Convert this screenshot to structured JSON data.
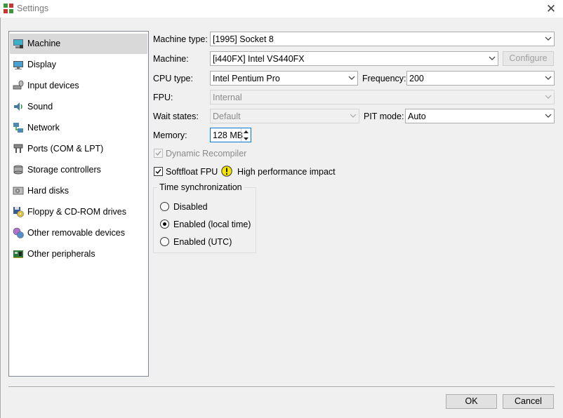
{
  "window": {
    "title": "Settings",
    "close_glyph": "✕"
  },
  "sidebar": {
    "items": [
      {
        "label": "Machine",
        "icon": "machine-icon",
        "selected": true
      },
      {
        "label": "Display",
        "icon": "display-icon"
      },
      {
        "label": "Input devices",
        "icon": "input-devices-icon"
      },
      {
        "label": "Sound",
        "icon": "sound-icon"
      },
      {
        "label": "Network",
        "icon": "network-icon"
      },
      {
        "label": "Ports (COM & LPT)",
        "icon": "ports-icon"
      },
      {
        "label": "Storage controllers",
        "icon": "storage-icon"
      },
      {
        "label": "Hard disks",
        "icon": "hard-disk-icon"
      },
      {
        "label": "Floppy & CD-ROM drives",
        "icon": "floppy-cdrom-icon"
      },
      {
        "label": "Other removable devices",
        "icon": "removable-devices-icon"
      },
      {
        "label": "Other peripherals",
        "icon": "peripherals-icon"
      }
    ]
  },
  "machine": {
    "machine_type_label": "Machine type:",
    "machine_type_value": "[1995] Socket 8",
    "machine_label": "Machine:",
    "machine_value": "[i440FX] Intel VS440FX",
    "configure_label": "Configure",
    "cpu_type_label": "CPU type:",
    "cpu_type_value": "Intel Pentium Pro",
    "frequency_label": "Frequency:",
    "frequency_value": "200",
    "fpu_label": "FPU:",
    "fpu_value": "Internal",
    "wait_states_label": "Wait states:",
    "wait_states_value": "Default",
    "pit_mode_label": "PIT mode:",
    "pit_mode_value": "Auto",
    "memory_label": "Memory:",
    "memory_value": "128 MB",
    "dynamic_recompiler_label": "Dynamic Recompiler",
    "dynamic_recompiler_checked": true,
    "softfloat_label": "Softfloat FPU",
    "softfloat_checked": true,
    "warning_text": "High performance impact",
    "time_sync": {
      "title": "Time synchronization",
      "options": [
        {
          "label": "Disabled",
          "selected": false
        },
        {
          "label": "Enabled (local time)",
          "selected": true
        },
        {
          "label": "Enabled (UTC)",
          "selected": false
        }
      ]
    }
  },
  "footer": {
    "ok_label": "OK",
    "cancel_label": "Cancel"
  },
  "colors": {
    "selection": "#d9d9d9",
    "warning": "#f5e400",
    "focus_border": "#0078d7"
  }
}
